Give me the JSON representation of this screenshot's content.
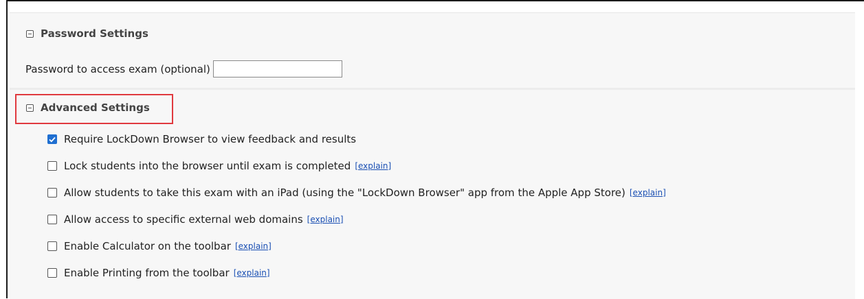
{
  "password_section": {
    "title": "Password Settings",
    "field_label": "Password to access exam (optional)",
    "field_value": ""
  },
  "advanced_section": {
    "title": "Advanced Settings",
    "highlight_color": "#e0393e",
    "options": [
      {
        "label": "Require LockDown Browser to view feedback and results",
        "checked": true,
        "explain": ""
      },
      {
        "label": "Lock students into the browser until exam is completed",
        "checked": false,
        "explain": "[explain]"
      },
      {
        "label": "Allow students to take this exam with an iPad (using the \"LockDown Browser\" app from the Apple App Store)",
        "checked": false,
        "explain": "[explain]"
      },
      {
        "label": "Allow access to specific external web domains",
        "checked": false,
        "explain": "[explain]"
      },
      {
        "label": "Enable Calculator on the toolbar",
        "checked": false,
        "explain": "[explain]"
      },
      {
        "label": "Enable Printing from the toolbar",
        "checked": false,
        "explain": "[explain]"
      }
    ]
  },
  "colors": {
    "checkbox_checked": "#1f6fd1",
    "link": "#1a4fb3",
    "panel_bg": "#f7f7f7"
  }
}
